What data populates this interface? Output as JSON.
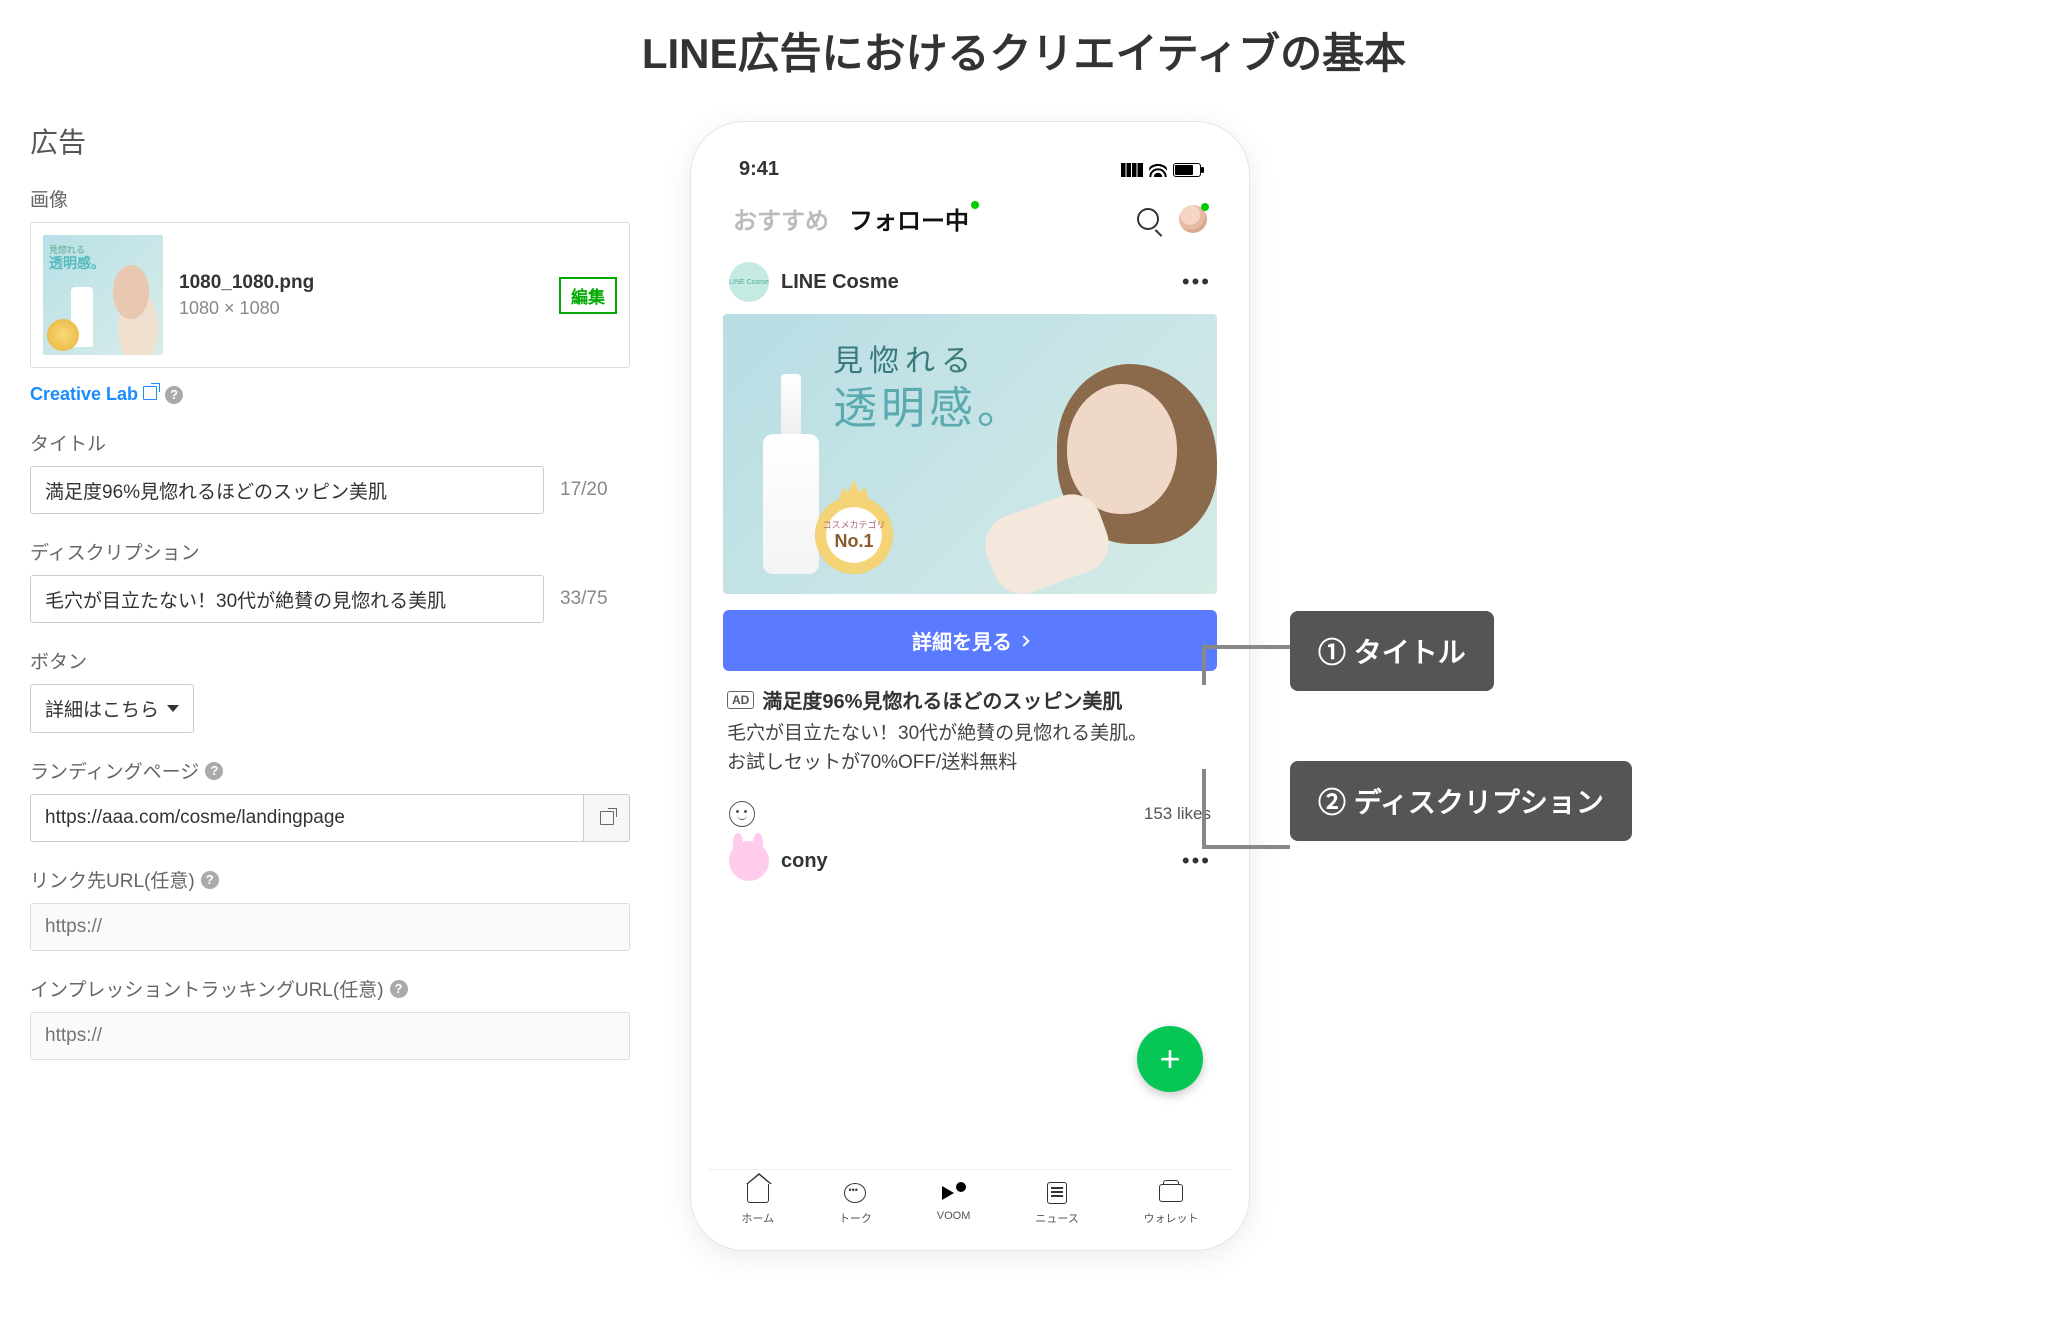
{
  "page_title": "LINE広告におけるクリエイティブの基本",
  "left": {
    "heading": "広告",
    "image": {
      "label": "画像",
      "filename": "1080_1080.png",
      "dimensions": "1080 × 1080",
      "thumb_line1": "見惚れる",
      "thumb_line2": "透明感。",
      "edit": "編集"
    },
    "creative_lab": "Creative Lab",
    "title": {
      "label": "タイトル",
      "value": "満足度96%見惚れるほどのスッピン美肌",
      "count": "17/20"
    },
    "description": {
      "label": "ディスクリプション",
      "value": "毛穴が目立たない！30代が絶賛の見惚れる美肌",
      "count": "33/75"
    },
    "button": {
      "label": "ボタン",
      "value": "詳細はこちら"
    },
    "landing_page": {
      "label": "ランディングページ",
      "value": "https://aaa.com/cosme/landingpage"
    },
    "link_url": {
      "label": "リンク先URL(任意)",
      "placeholder": "https://"
    },
    "impression_url": {
      "label": "インプレッショントラッキングURL(任意)",
      "placeholder": "https://"
    }
  },
  "phone": {
    "time": "9:41",
    "tabs": {
      "recommend": "おすすめ",
      "following": "フォロー中"
    },
    "post": {
      "avatar_text": "LINE Cosme",
      "username": "LINE Cosme",
      "ad_image": {
        "line1": "見惚れる",
        "line2": "透明感。",
        "badge_top": "コスメカテゴリ",
        "badge_main": "No.1"
      },
      "cta": "詳細を見る",
      "ad_badge": "AD",
      "ad_title": "満足度96%見惚れるほどのスッピン美肌",
      "ad_desc_l1": "毛穴が目立たない！30代が絶賛の見惚れる美肌。",
      "ad_desc_l2": "お試しセットが70%OFF/送料無料",
      "likes": "153 likes"
    },
    "next_user": "cony",
    "nav": {
      "home": "ホーム",
      "talk": "トーク",
      "voom": "VOOM",
      "news": "ニュース",
      "wallet": "ウォレット"
    }
  },
  "callouts": {
    "c1": "① タイトル",
    "c2": "② ディスクリプション"
  }
}
